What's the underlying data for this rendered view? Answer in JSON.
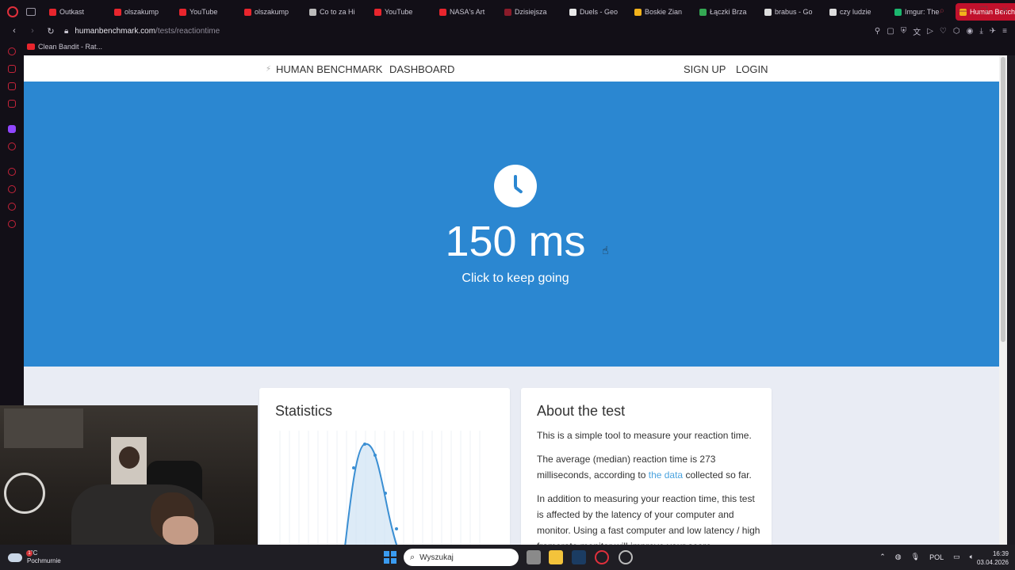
{
  "browser": {
    "tabs": [
      {
        "label": "Outkast",
        "fav": "#e8252d"
      },
      {
        "label": "olszakump",
        "fav": "#e8252d"
      },
      {
        "label": "YouTube",
        "fav": "#e8252d"
      },
      {
        "label": "olszakump",
        "fav": "#e8252d"
      },
      {
        "label": "Co to za Hi",
        "fav": "#bbbbbb"
      },
      {
        "label": "YouTube",
        "fav": "#e8252d"
      },
      {
        "label": "NASA's Art",
        "fav": "#e8252d"
      },
      {
        "label": "Dzisiejsza",
        "fav": "#8b1b2a"
      },
      {
        "label": "Duels - Geo",
        "fav": "#e8e8e8"
      },
      {
        "label": "Boskie Zian",
        "fav": "#f2b21b"
      },
      {
        "label": "Łączki Brza",
        "fav": "#34a853"
      },
      {
        "label": "brabus - Go",
        "fav": "#dddddd"
      },
      {
        "label": "czy ludzie",
        "fav": "#dddddd"
      },
      {
        "label": "Imgur: The",
        "fav": "#1bb76e"
      },
      {
        "label": "Human Benchmark",
        "fav": "#f2b21b"
      }
    ],
    "url_domain": "humanbenchmark.com",
    "url_path": "/tests/reactiontime",
    "bookmark_label": "Clean Bandit - Rat..."
  },
  "site": {
    "brand": "HUMAN BENCHMARK",
    "dashboard": "DASHBOARD",
    "signup": "SIGN UP",
    "login": "LOGIN"
  },
  "hero": {
    "result": "150 ms",
    "subtext": "Click to keep going",
    "bg_color": "#2b87d1"
  },
  "stats_card": {
    "title": "Statistics"
  },
  "about_card": {
    "title": "About the test",
    "p1": "This is a simple tool to measure your reaction time.",
    "p2_before": "The average (median) reaction time is 273 milliseconds, according to ",
    "p2_link": "the data",
    "p2_after": " collected so far.",
    "p3": "In addition to measuring your reaction time, this test is affected by the latency of your computer and monitor. Using a fast computer and low latency / high framerate monitor will improve your score."
  },
  "taskbar": {
    "temperature": "6°C",
    "weather": "Pochmurnie",
    "weather_badge": "1",
    "search_placeholder": "Wyszukaj",
    "language": "POL",
    "time": "16:39",
    "date": "03.04.2026"
  }
}
